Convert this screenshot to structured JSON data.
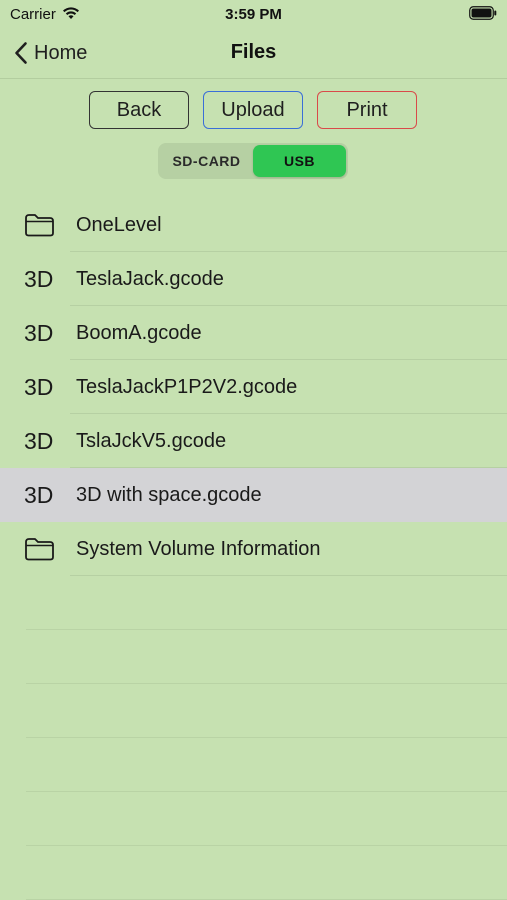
{
  "status_bar": {
    "carrier": "Carrier",
    "time": "3:59 PM"
  },
  "nav": {
    "back_label": "Home",
    "title": "Files"
  },
  "actions": {
    "back": "Back",
    "upload": "Upload",
    "print": "Print"
  },
  "storage": {
    "options": [
      "SD-CARD",
      "USB"
    ],
    "selected": "USB"
  },
  "files": [
    {
      "icon": "folder-icon",
      "name": "OneLevel"
    },
    {
      "icon": "3d-icon",
      "label": "3D",
      "name": "TeslaJack.gcode"
    },
    {
      "icon": "3d-icon",
      "label": "3D",
      "name": "BoomA.gcode"
    },
    {
      "icon": "3d-icon",
      "label": "3D",
      "name": "TeslaJackP1P2V2.gcode"
    },
    {
      "icon": "3d-icon",
      "label": "3D",
      "name": "TslaJckV5.gcode"
    },
    {
      "icon": "3d-icon",
      "label": "3D",
      "name": "3D with space.gcode",
      "highlighted": true
    },
    {
      "icon": "folder-icon",
      "name": "System Volume Information"
    }
  ],
  "colors": {
    "background": "#c6e1b1",
    "selected_segment": "#2fc653",
    "upload_border": "#3a6ed8",
    "print_border": "#d94a4a",
    "row_highlight": "#d3d3d6"
  }
}
